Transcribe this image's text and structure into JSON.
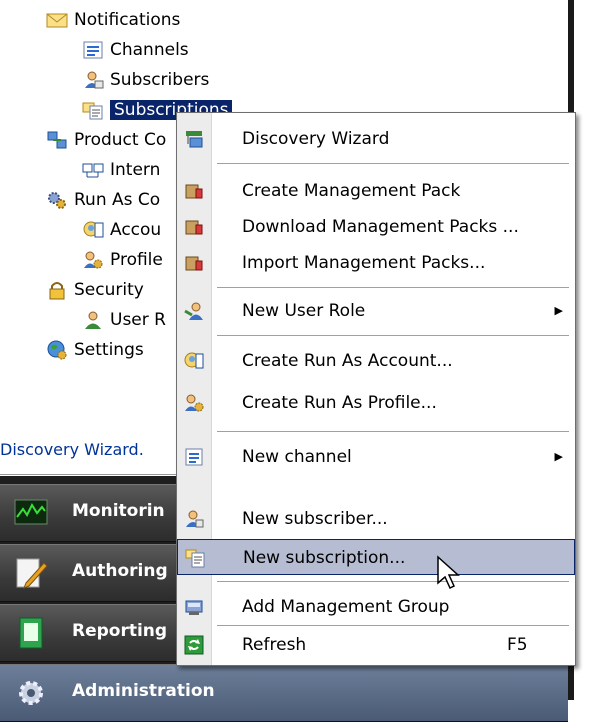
{
  "tree": {
    "items": [
      {
        "label": "Notifications",
        "icon": "envelope-icon"
      },
      {
        "label": "Channels",
        "icon": "channel-icon"
      },
      {
        "label": "Subscribers",
        "icon": "subscriber-icon"
      },
      {
        "label": "Subscriptions",
        "icon": "subscription-icon"
      },
      {
        "label": "Product Co",
        "icon": "connector-icon"
      },
      {
        "label": "Intern",
        "icon": "internal-connector-icon"
      },
      {
        "label": "Run As Co",
        "icon": "gears-icon"
      },
      {
        "label": "Accou",
        "icon": "account-icon"
      },
      {
        "label": "Profile",
        "icon": "profile-icon"
      },
      {
        "label": "Security",
        "icon": "lock-icon"
      },
      {
        "label": "User R",
        "icon": "user-role-icon"
      },
      {
        "label": "Settings",
        "icon": "settings-globe-icon"
      }
    ]
  },
  "status": {
    "text": "Discovery Wizard."
  },
  "wunderbar": {
    "items": [
      {
        "label": "Monitorin",
        "icon": "monitoring-icon"
      },
      {
        "label": "Authoring",
        "icon": "authoring-icon"
      },
      {
        "label": "Reporting",
        "icon": "reporting-icon"
      },
      {
        "label": "Administration",
        "icon": "administration-icon"
      }
    ]
  },
  "menu": {
    "items": [
      {
        "label": "Discovery Wizard",
        "icon": "discovery-wizard-icon"
      },
      {
        "label": "Create Management Pack",
        "icon": "management-pack-icon"
      },
      {
        "label": "Download Management Packs ...",
        "icon": "download-pack-icon"
      },
      {
        "label": "Import Management Packs...",
        "icon": "import-pack-icon"
      },
      {
        "label": "New User Role",
        "icon": "user-role-icon",
        "submenu": true
      },
      {
        "label": "Create Run As Account...",
        "icon": "run-as-account-icon"
      },
      {
        "label": "Create Run As Profile...",
        "icon": "run-as-profile-icon"
      },
      {
        "label": "New channel",
        "icon": "channel-icon",
        "submenu": true
      },
      {
        "label": "New subscriber...",
        "icon": "subscriber-icon"
      },
      {
        "label": "New subscription...",
        "icon": "subscription-icon",
        "highlighted": true
      },
      {
        "label": "Add Management Group",
        "icon": "management-group-icon"
      },
      {
        "label": "Refresh",
        "icon": "refresh-icon",
        "shortcut": "F5"
      }
    ]
  },
  "colors": {
    "selection": "#0a246a",
    "menu_hover": "#b6bdd2",
    "link": "#003399"
  }
}
